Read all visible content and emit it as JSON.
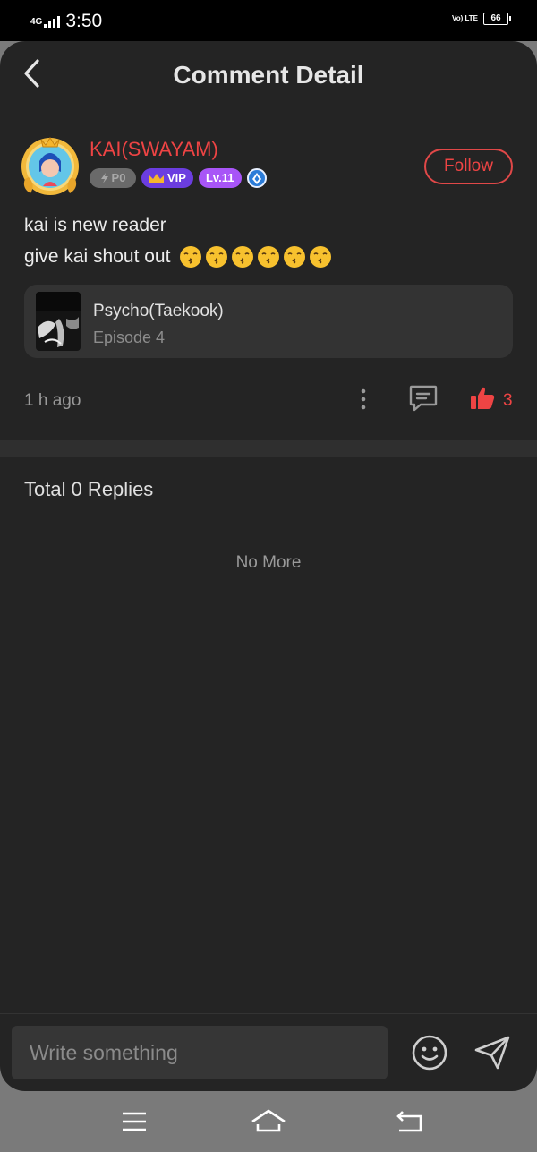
{
  "status_bar": {
    "network": "4G",
    "time": "3:50",
    "volte": "Vo) LTE",
    "battery": "66"
  },
  "header": {
    "title": "Comment Detail",
    "back_icon": "chevron-left-icon"
  },
  "comment": {
    "username": "KAI(SWAYAM)",
    "badges": {
      "power": "P0",
      "vip": "VIP",
      "level": "Lv.11"
    },
    "follow_label": "Follow",
    "text_line1": "kai is new reader",
    "text_line2": "give kai shout out",
    "emoji": "kissing-face",
    "emoji_count": 6,
    "book": {
      "title": "Psycho(Taekook)",
      "episode": "Episode 4"
    },
    "time": "1 h ago",
    "likes": "3"
  },
  "replies": {
    "title": "Total 0 Replies",
    "no_more": "No More"
  },
  "composer": {
    "placeholder": "Write something"
  },
  "colors": {
    "accent": "#ee4444",
    "background": "#242424",
    "card": "#333333"
  }
}
